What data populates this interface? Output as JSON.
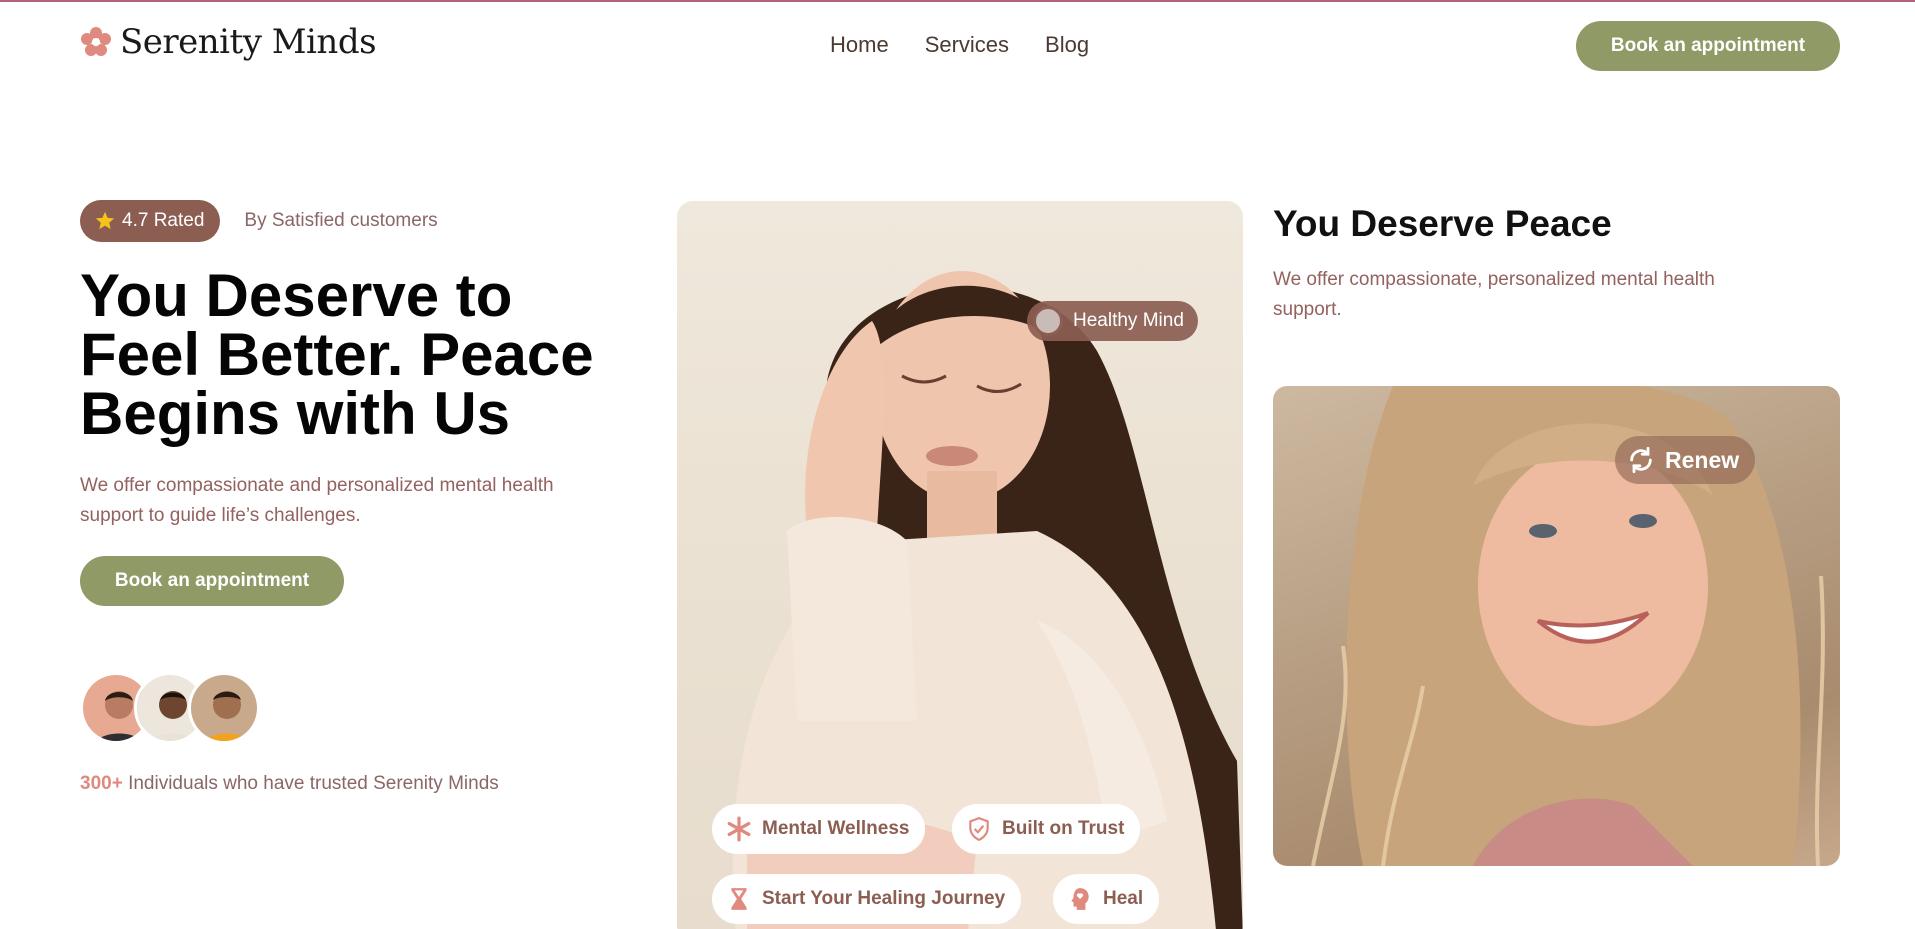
{
  "brand": {
    "name": "Serenity Minds",
    "logo_icon": "flower-icon",
    "accent": "#e0897e"
  },
  "nav": {
    "items": [
      "Home",
      "Services",
      "Blog"
    ]
  },
  "header": {
    "cta": "Book an appointment"
  },
  "hero": {
    "rating": "4.7 Rated",
    "rating_icon": "star-icon",
    "rating_sub": "By Satisfied customers",
    "title": "You Deserve to Feel Better. Peace Begins with Us",
    "description": "We offer compassionate and personalized mental health support to guide life’s challenges.",
    "cta": "Book an appointment",
    "trust_count": "300+",
    "trust_text": " Individuals who have trusted Serenity Minds"
  },
  "center_card": {
    "badge": "Healthy Mind",
    "chips": [
      {
        "label": "Mental Wellness",
        "icon": "asterisk-icon"
      },
      {
        "label": "Built on Trust",
        "icon": "shield-check-icon"
      },
      {
        "label": "Start Your Healing Journey",
        "icon": "hourglass-icon"
      },
      {
        "label": "Heal",
        "icon": "head-heart-icon"
      }
    ]
  },
  "right": {
    "title": "You Deserve Peace",
    "description": "We offer compassionate, personalized mental health support.",
    "badge": "Renew",
    "badge_icon": "refresh-icon"
  },
  "colors": {
    "button": "#8f9a66",
    "badge": "#8c5e52",
    "text_muted": "#93625f"
  }
}
